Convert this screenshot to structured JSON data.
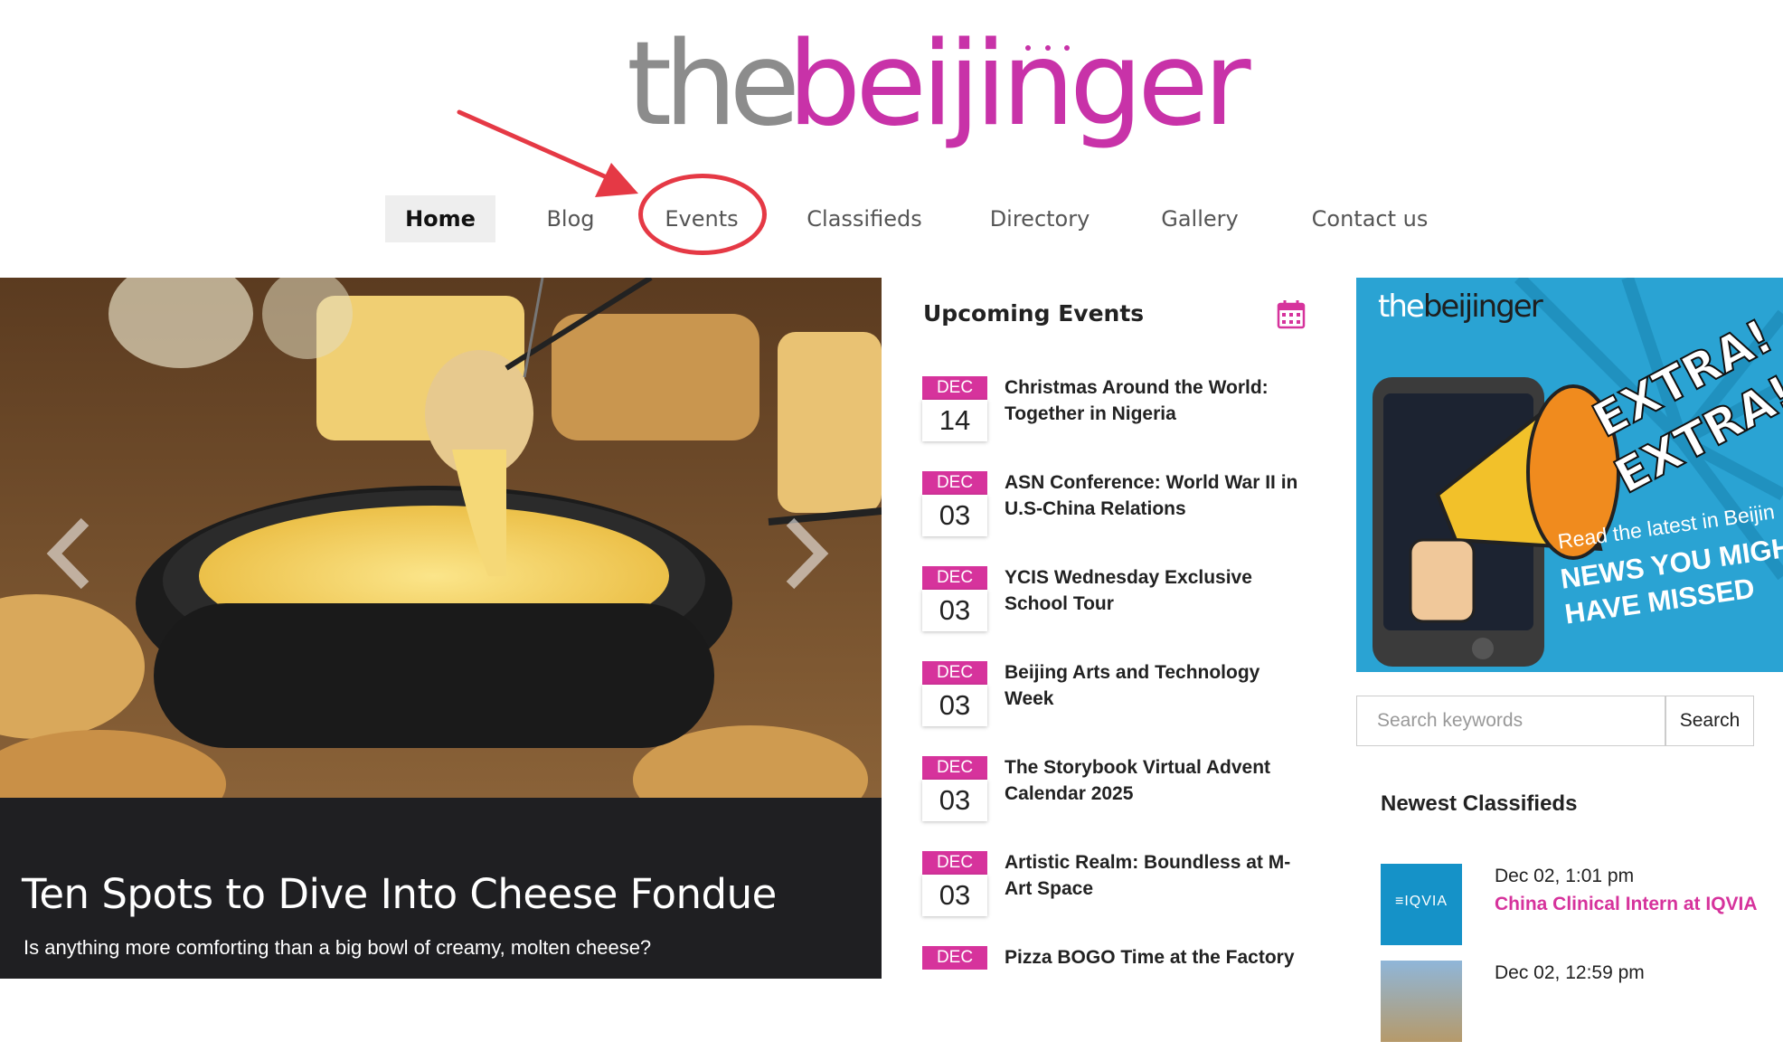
{
  "logo": {
    "part1": "the",
    "part2": "beijinger",
    "colors": {
      "the": "#8c8c8c",
      "beijinger": "#c832a8"
    }
  },
  "nav": {
    "items": [
      "Home",
      "Blog",
      "Events",
      "Classifieds",
      "Directory",
      "Gallery",
      "Contact us"
    ],
    "active": "Home",
    "highlighted": "Events"
  },
  "hero": {
    "title": "Ten Spots to Dive Into Cheese Fondue",
    "subtitle": "Is anything more comforting than a big bowl of creamy, molten cheese?",
    "image": "cheese-fondue-photo"
  },
  "events": {
    "heading": "Upcoming Events",
    "icon": "calendar-icon",
    "items": [
      {
        "month": "DEC",
        "day": "14",
        "title": "Christmas Around the World: Together in Nigeria"
      },
      {
        "month": "DEC",
        "day": "03",
        "title": "ASN Conference: World War II in U.S-China Relations"
      },
      {
        "month": "DEC",
        "day": "03",
        "title": "YCIS Wednesday Exclusive School Tour"
      },
      {
        "month": "DEC",
        "day": "03",
        "title": "Beijing Arts and Technology Week"
      },
      {
        "month": "DEC",
        "day": "03",
        "title": "The Storybook Virtual Advent Calendar 2025"
      },
      {
        "month": "DEC",
        "day": "03",
        "title": "Artistic Realm: Boundless at M-Art Space"
      },
      {
        "month": "DEC",
        "day": "",
        "title": "Pizza BOGO Time at the Factory"
      }
    ]
  },
  "ad": {
    "brand_the": "the",
    "brand_beijinger": "beijinger",
    "headline1": "EXTRA!",
    "headline2": "EXTRA!",
    "tagline": "Read the latest in Beijin",
    "cta1": "NEWS YOU MIGH",
    "cta2": "HAVE MISSED"
  },
  "search": {
    "placeholder": "Search keywords",
    "button": "Search"
  },
  "classifieds": {
    "heading": "Newest Classifieds",
    "items": [
      {
        "date": "Dec 02, 1:01 pm",
        "title": "China Clinical Intern at IQVIA",
        "thumb_text": "≡IQVIA"
      },
      {
        "date": "Dec 02, 12:59 pm",
        "title": "",
        "thumb_text": ""
      }
    ]
  },
  "colors": {
    "accent": "#d6339c",
    "annotation": "#e53945",
    "caption_bg": "#1f1f22"
  }
}
